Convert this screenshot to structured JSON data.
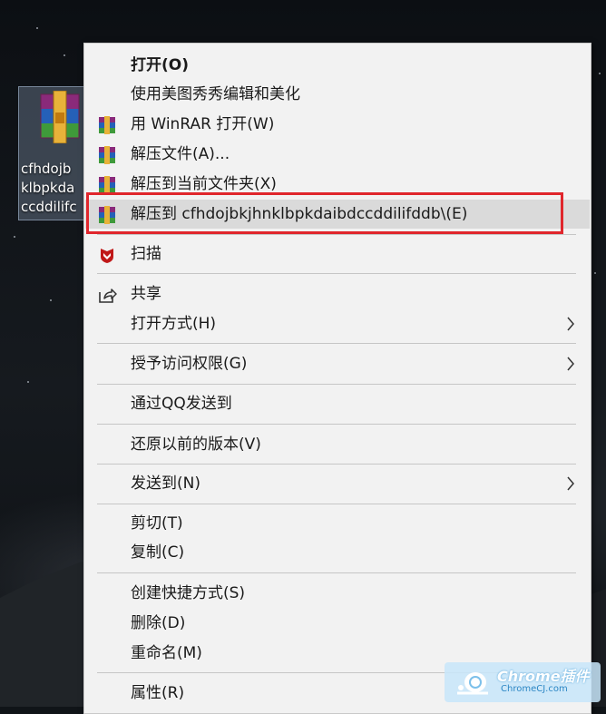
{
  "desktop": {
    "file_name_lines": "cfhdojb\nklbpkda\nccddilifc"
  },
  "menu": {
    "open": "打开(O)",
    "meitu": "使用美图秀秀编辑和美化",
    "winrar_open": "用 WinRAR 打开(W)",
    "extract_files": "解压文件(A)...",
    "extract_here": "解压到当前文件夹(X)",
    "extract_to_folder": "解压到 cfhdojbkjhnklbpkdaibdccddilifddb\\(E)",
    "scan": "扫描",
    "share": "共享",
    "open_with": "打开方式(H)",
    "grant_access": "授予访问权限(G)",
    "send_qq": "通过QQ发送到",
    "restore_versions": "还原以前的版本(V)",
    "send_to": "发送到(N)",
    "cut": "剪切(T)",
    "copy": "复制(C)",
    "create_shortcut": "创建快捷方式(S)",
    "delete": "删除(D)",
    "rename": "重命名(M)",
    "properties": "属性(R)"
  },
  "watermark": {
    "brand": "Chrome插件",
    "domain": "ChromeCJ.com"
  },
  "colors": {
    "highlight_border": "#e0262c",
    "menu_bg": "#f2f2f2",
    "hover_bg": "#dadada",
    "mcafee_red": "#c01818"
  }
}
